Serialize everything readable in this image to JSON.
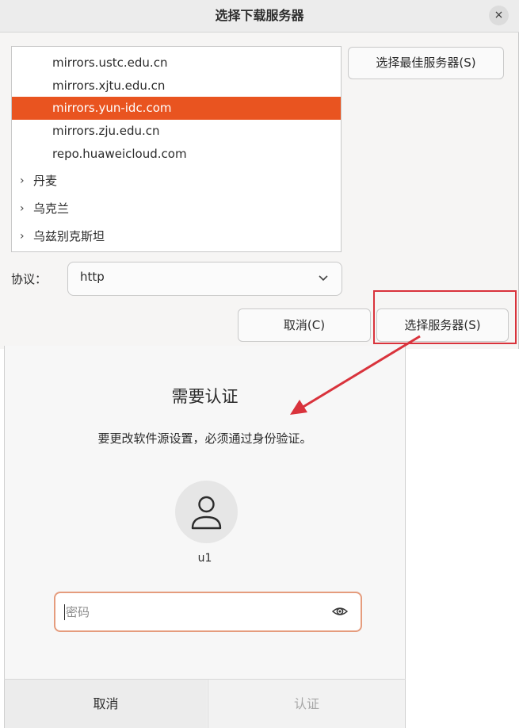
{
  "server_dialog": {
    "title": "选择下载服务器",
    "close_glyph": "×",
    "servers": [
      {
        "label": "mirrors.ustc.edu.cn",
        "selected": false
      },
      {
        "label": "mirrors.xjtu.edu.cn",
        "selected": false
      },
      {
        "label": "mirrors.yun-idc.com",
        "selected": true
      },
      {
        "label": "mirrors.zju.edu.cn",
        "selected": false
      },
      {
        "label": "repo.huaweicloud.com",
        "selected": false
      }
    ],
    "countries": [
      {
        "chevron": "›",
        "label": "丹麦"
      },
      {
        "chevron": "›",
        "label": "乌克兰"
      },
      {
        "chevron": "›",
        "label": "乌兹别克斯坦"
      }
    ],
    "best_server_label": "选择最佳服务器(S)",
    "protocol_label": "协议：",
    "protocol_value": "http",
    "cancel_label": "取消(C)",
    "select_label": "选择服务器(S)",
    "accent_color": "#e95420",
    "highlight_color": "#d9333c"
  },
  "auth_dialog": {
    "title": "需要认证",
    "message": "要更改软件源设置，必须通过身份验证。",
    "username": "u1",
    "password_placeholder": "密码",
    "cancel_label": "取消",
    "auth_label": "认证"
  },
  "icons": {
    "close": "close-icon",
    "chevron_right": "chevron-right-icon",
    "dropdown": "chevron-down-icon",
    "avatar": "user-avatar-icon",
    "password_reveal": "eye-icon",
    "annotation_arrow": "arrow-icon"
  }
}
